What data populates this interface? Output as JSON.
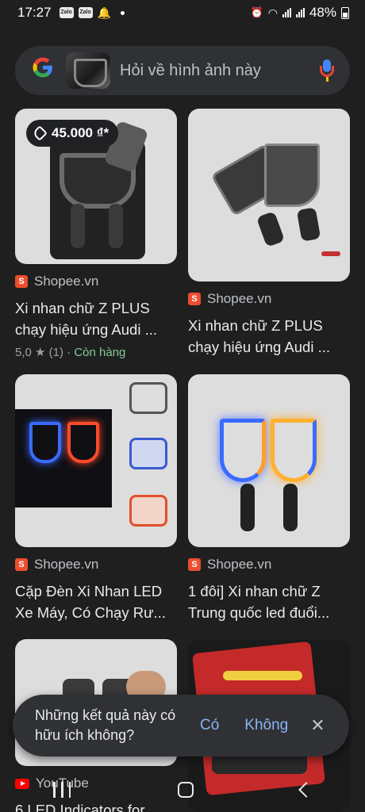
{
  "status_bar": {
    "time": "17:27",
    "app_icons": [
      "Zalo",
      "Zalo"
    ],
    "battery": "48%"
  },
  "search": {
    "placeholder": "Hỏi về hình ảnh này"
  },
  "results": [
    {
      "price": "45.000 ₫*",
      "source": "Shopee.vn",
      "title": "Xi nhan chữ Z PLUS chạy hiệu ứng Audi ...",
      "rating": "5,0",
      "reviews": "(1)",
      "stock": "Còn hàng"
    },
    {
      "source": "Shopee.vn",
      "title": "Xi nhan chữ Z PLUS chạy hiệu ứng Audi ..."
    },
    {
      "source": "Shopee.vn",
      "title": "Cặp Đèn Xi Nhan LED Xe Máy, Có Chạy Rư..."
    },
    {
      "source": "Shopee.vn",
      "title": "1 đôi] Xi nhan chữ Z Trung quốc led đuổi..."
    },
    {
      "source": "YouTube",
      "title": "6 LED Indicators for"
    }
  ],
  "feedback": {
    "question": "Những kết quả này có hữu ích không?",
    "yes": "Có",
    "no": "Không",
    "close": "✕"
  },
  "icons": {
    "source_shopee": "shopee-bag-icon",
    "source_youtube": "youtube-icon",
    "mic": "mic-icon",
    "google": "google-logo"
  }
}
